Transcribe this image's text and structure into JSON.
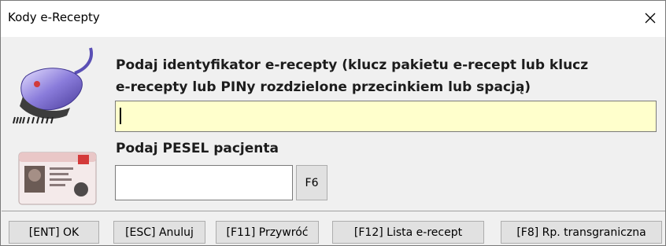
{
  "window": {
    "title": "Kody e-Recepty",
    "close_icon": "close-icon"
  },
  "form": {
    "identifier_label_line1": "Podaj identyfikator e-recepty (klucz pakietu e-recept lub klucz",
    "identifier_label_line2": "e-recepty lub PINy rozdzielone przecinkiem lub spacją)",
    "identifier_value": "",
    "pesel_label": "Podaj PESEL pacjenta",
    "pesel_value": "",
    "f6_label": "F6",
    "scanner_icon": "barcode-scanner-icon",
    "id_card_icon": "id-card-icon",
    "colors": {
      "identifier_bg": "#ffffcc",
      "window_bg": "#f0f0f0"
    }
  },
  "buttons": {
    "ok": "[ENT] OK",
    "cancel": "[ESC] Anuluj",
    "restore": "[F11] Przywróć",
    "list": "[F12] Lista e-recept",
    "crossborder": "[F8] Rp. transgraniczna"
  }
}
